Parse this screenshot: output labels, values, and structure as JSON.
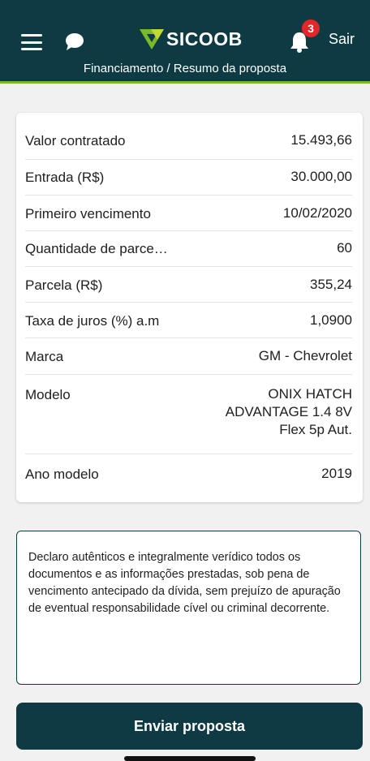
{
  "header": {
    "brand": "SICOOB",
    "notification_count": "3",
    "logout_label": "Sair",
    "breadcrumb": "Financiamento / Resumo da proposta"
  },
  "summary": {
    "rows": [
      {
        "label": "Valor contratado",
        "value": "15.493,66"
      },
      {
        "label": "Entrada (R$)",
        "value": "30.000,00"
      },
      {
        "label": "Primeiro vencimento",
        "value": "10/02/2020"
      },
      {
        "label": "Quantidade de parce…",
        "value": "60"
      },
      {
        "label": "Parcela (R$)",
        "value": "355,24"
      },
      {
        "label": "Taxa de juros (%) a.m",
        "value": "1,0900"
      },
      {
        "label": "Marca",
        "value": "GM - Chevrolet"
      },
      {
        "label": "Modelo",
        "value_lines": [
          "ONIX HATCH",
          "ADVANTAGE 1.4 8V",
          "Flex 5p Aut."
        ]
      },
      {
        "label": "Ano modelo",
        "value": "2019"
      }
    ]
  },
  "declaration": {
    "text": "Declaro autênticos e integralmente verídico todos os documentos e as informações prestadas, sob pena de vencimento antecipado da dívida, sem prejuízo de apuração de eventual responsabilidade cível ou criminal decorrente."
  },
  "actions": {
    "submit_label": "Enviar proposta"
  },
  "colors": {
    "header_bg": "#0e3b43",
    "accent_green": "#7ab929",
    "badge_red": "#e2262a"
  },
  "icons": [
    "menu-icon",
    "chat-icon",
    "sicoob-logo-icon",
    "bell-icon"
  ]
}
